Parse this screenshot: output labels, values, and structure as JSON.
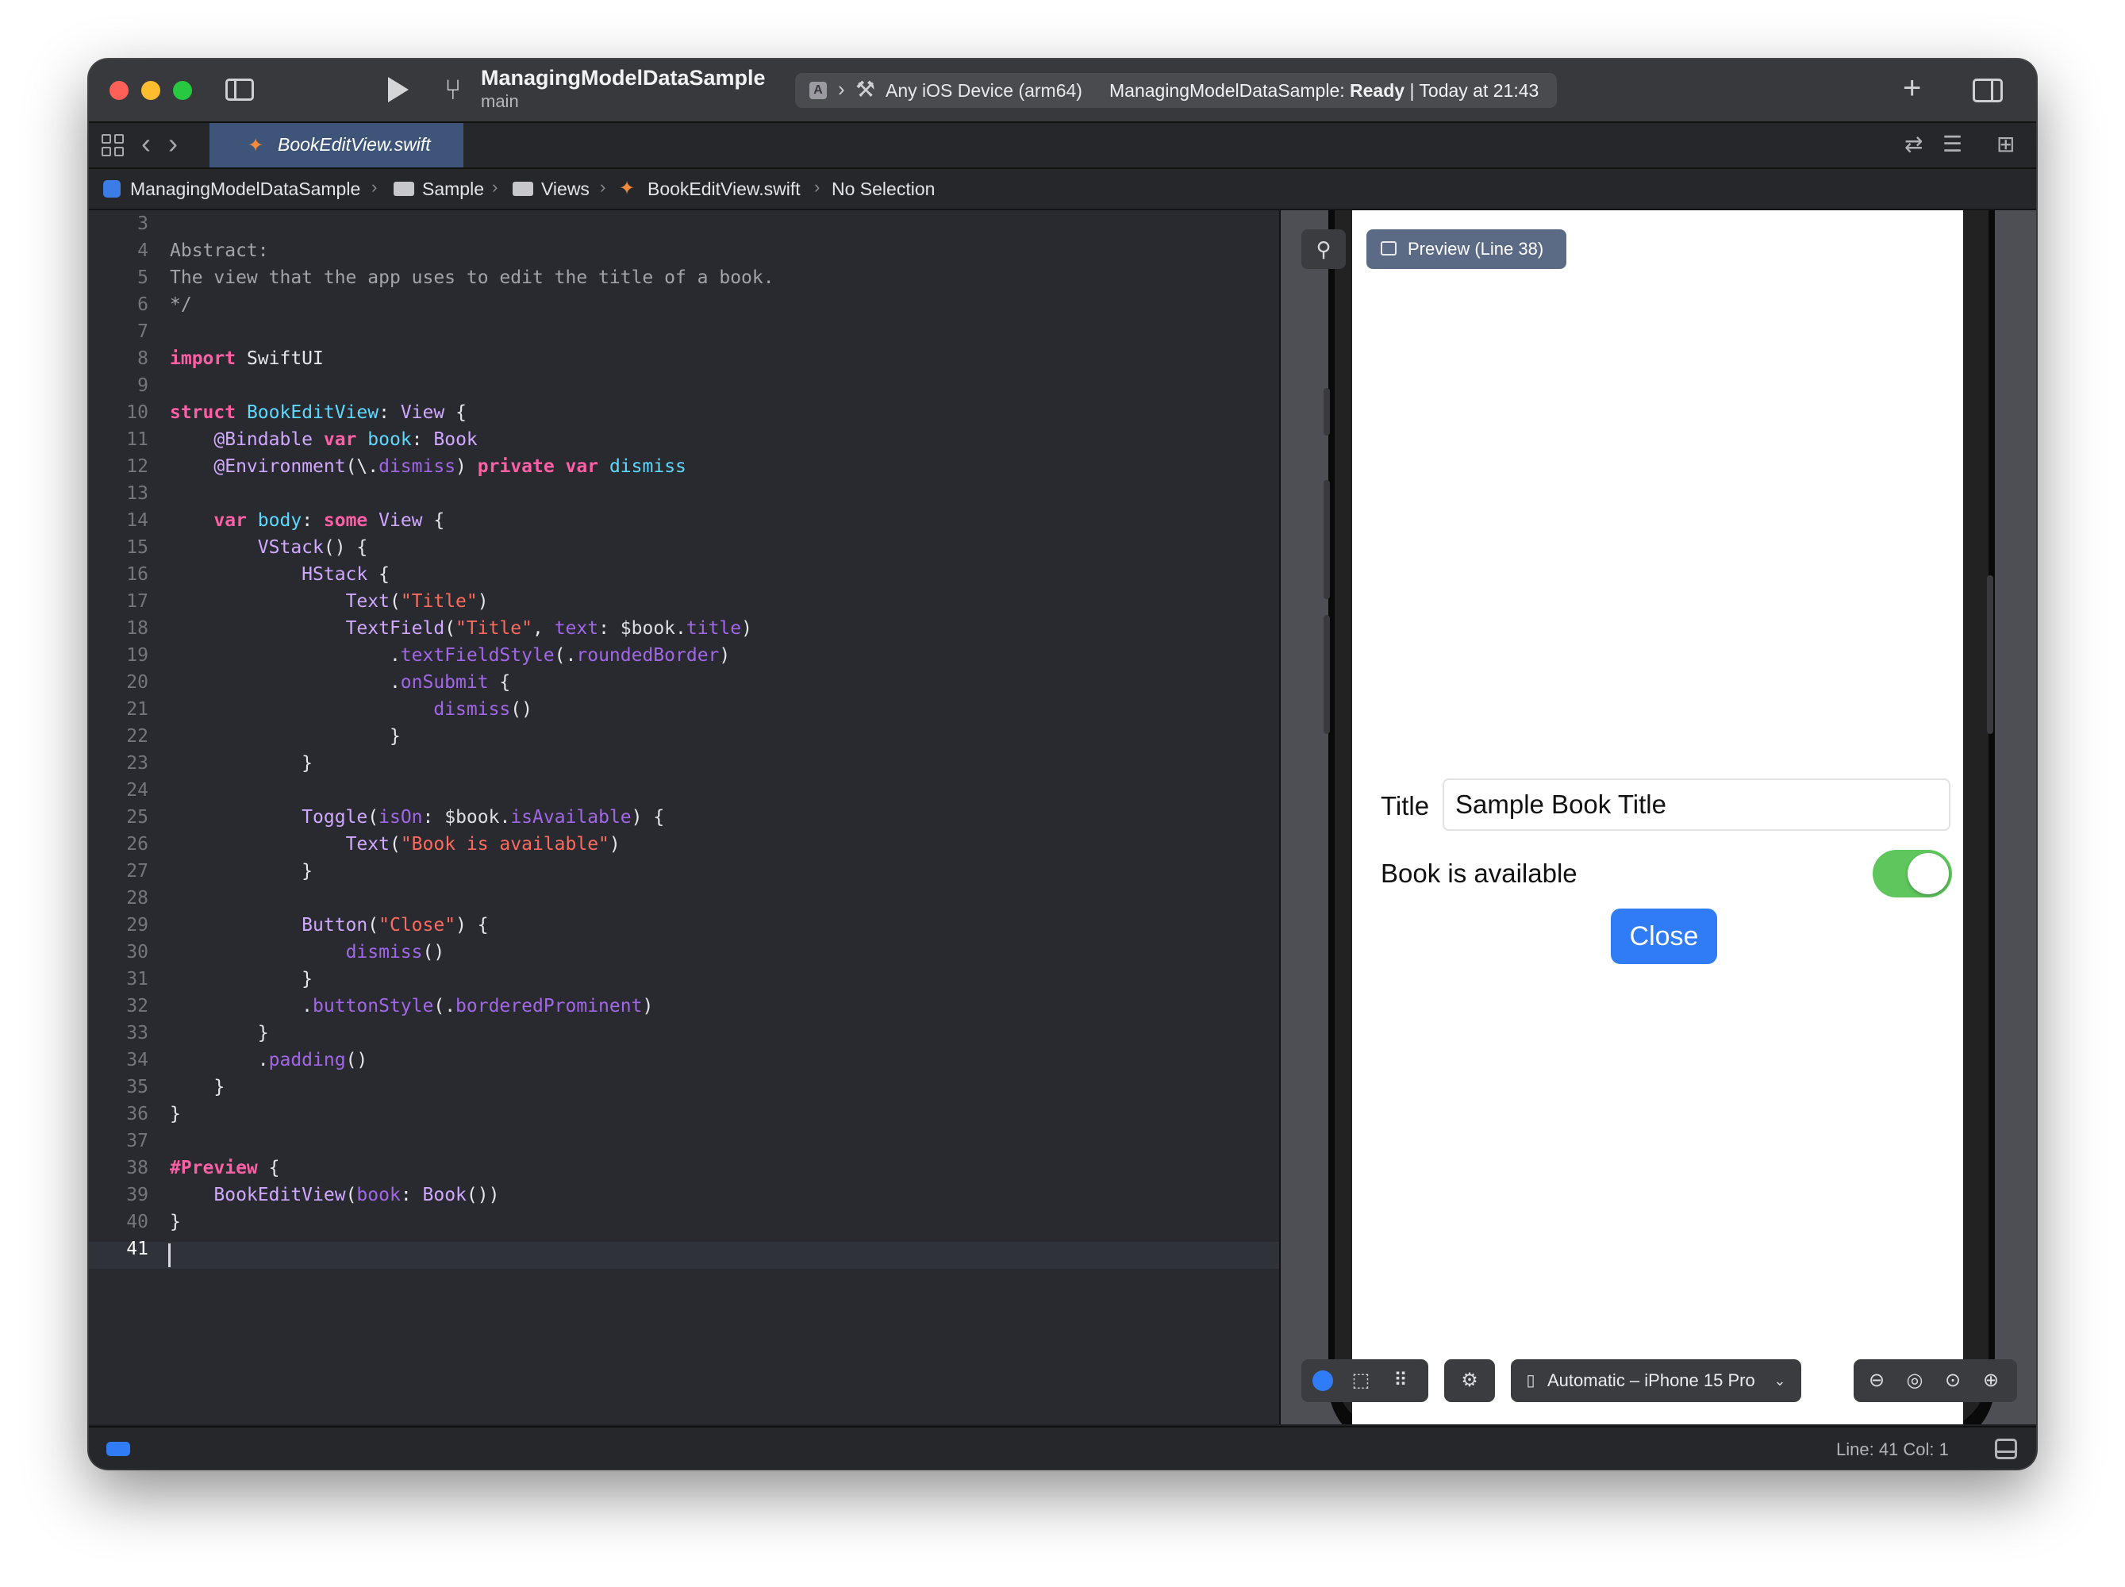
{
  "toolbar": {
    "project_name": "ManagingModelDataSample",
    "branch": "main",
    "device": "Any iOS Device (arm64)",
    "build_status_project": "ManagingModelDataSample:",
    "build_status_state": "Ready",
    "build_status_time": "| Today at 21:43"
  },
  "tabs": [
    {
      "label": "BookEditView.swift",
      "active": true
    }
  ],
  "breadcrumb": [
    "ManagingModelDataSample",
    "Sample",
    "Views",
    "BookEditView.swift",
    "No Selection"
  ],
  "editor": {
    "current_line": 41,
    "lines": [
      {
        "n": "3",
        "tokens": []
      },
      {
        "n": "4",
        "tokens": [
          [
            "cm",
            "Abstract:"
          ]
        ]
      },
      {
        "n": "5",
        "tokens": [
          [
            "cm",
            "The view that the app uses to edit the title of a book."
          ]
        ]
      },
      {
        "n": "6",
        "tokens": [
          [
            "cm",
            "*/"
          ]
        ]
      },
      {
        "n": "7",
        "tokens": []
      },
      {
        "n": "8",
        "tokens": [
          [
            "kw",
            "import"
          ],
          [
            "pl",
            " SwiftUI"
          ]
        ]
      },
      {
        "n": "9",
        "tokens": []
      },
      {
        "n": "10",
        "tokens": [
          [
            "kw",
            "struct"
          ],
          [
            "pl",
            " "
          ],
          [
            "ty",
            "BookEditView"
          ],
          [
            "pl",
            ": "
          ],
          [
            "ot",
            "View"
          ],
          [
            "pl",
            " {"
          ]
        ]
      },
      {
        "n": "11",
        "tokens": [
          [
            "pl",
            "    "
          ],
          [
            "ot",
            "@Bindable"
          ],
          [
            "pl",
            " "
          ],
          [
            "kw",
            "var"
          ],
          [
            "pl",
            " "
          ],
          [
            "ty",
            "book"
          ],
          [
            "pl",
            ": "
          ],
          [
            "ot",
            "Book"
          ]
        ]
      },
      {
        "n": "12",
        "tokens": [
          [
            "pl",
            "    "
          ],
          [
            "ot",
            "@Environment"
          ],
          [
            "pl",
            "(\\."
          ],
          [
            "nm",
            "dismiss"
          ],
          [
            "pl",
            ") "
          ],
          [
            "kw",
            "private"
          ],
          [
            "pl",
            " "
          ],
          [
            "kw",
            "var"
          ],
          [
            "pl",
            " "
          ],
          [
            "ty",
            "dismiss"
          ]
        ]
      },
      {
        "n": "13",
        "tokens": []
      },
      {
        "n": "14",
        "tokens": [
          [
            "pl",
            "    "
          ],
          [
            "kw",
            "var"
          ],
          [
            "pl",
            " "
          ],
          [
            "ty",
            "body"
          ],
          [
            "pl",
            ": "
          ],
          [
            "kw",
            "some"
          ],
          [
            "pl",
            " "
          ],
          [
            "ot",
            "View"
          ],
          [
            "pl",
            " {"
          ]
        ]
      },
      {
        "n": "15",
        "tokens": [
          [
            "pl",
            "        "
          ],
          [
            "ot",
            "VStack"
          ],
          [
            "pl",
            "() {"
          ]
        ]
      },
      {
        "n": "16",
        "tokens": [
          [
            "pl",
            "            "
          ],
          [
            "ot",
            "HStack"
          ],
          [
            "pl",
            " {"
          ]
        ]
      },
      {
        "n": "17",
        "tokens": [
          [
            "pl",
            "                "
          ],
          [
            "ot",
            "Text"
          ],
          [
            "pl",
            "("
          ],
          [
            "st",
            "\"Title\""
          ],
          [
            "pl",
            ")"
          ]
        ]
      },
      {
        "n": "18",
        "tokens": [
          [
            "pl",
            "                "
          ],
          [
            "ot",
            "TextField"
          ],
          [
            "pl",
            "("
          ],
          [
            "st",
            "\"Title\""
          ],
          [
            "pl",
            ", "
          ],
          [
            "nm",
            "text"
          ],
          [
            "pl",
            ": "
          ],
          [
            "sw",
            "$book"
          ],
          [
            "pl",
            "."
          ],
          [
            "nm",
            "title"
          ],
          [
            "pl",
            ")"
          ]
        ]
      },
      {
        "n": "19",
        "tokens": [
          [
            "pl",
            "                    ."
          ],
          [
            "nm",
            "textFieldStyle"
          ],
          [
            "pl",
            "(."
          ],
          [
            "nm",
            "roundedBorder"
          ],
          [
            "pl",
            ")"
          ]
        ]
      },
      {
        "n": "20",
        "tokens": [
          [
            "pl",
            "                    ."
          ],
          [
            "nm",
            "onSubmit"
          ],
          [
            "pl",
            " {"
          ]
        ]
      },
      {
        "n": "21",
        "tokens": [
          [
            "pl",
            "                        "
          ],
          [
            "nm",
            "dismiss"
          ],
          [
            "pl",
            "()"
          ]
        ]
      },
      {
        "n": "22",
        "tokens": [
          [
            "pl",
            "                    }"
          ]
        ]
      },
      {
        "n": "23",
        "tokens": [
          [
            "pl",
            "            }"
          ]
        ]
      },
      {
        "n": "24",
        "tokens": []
      },
      {
        "n": "25",
        "tokens": [
          [
            "pl",
            "            "
          ],
          [
            "ot",
            "Toggle"
          ],
          [
            "pl",
            "("
          ],
          [
            "nm",
            "isOn"
          ],
          [
            "pl",
            ": "
          ],
          [
            "sw",
            "$book"
          ],
          [
            "pl",
            "."
          ],
          [
            "nm",
            "isAvailable"
          ],
          [
            "pl",
            ") {"
          ]
        ]
      },
      {
        "n": "26",
        "tokens": [
          [
            "pl",
            "                "
          ],
          [
            "ot",
            "Text"
          ],
          [
            "pl",
            "("
          ],
          [
            "st",
            "\"Book is available\""
          ],
          [
            "pl",
            ")"
          ]
        ]
      },
      {
        "n": "27",
        "tokens": [
          [
            "pl",
            "            }"
          ]
        ]
      },
      {
        "n": "28",
        "tokens": []
      },
      {
        "n": "29",
        "tokens": [
          [
            "pl",
            "            "
          ],
          [
            "ot",
            "Button"
          ],
          [
            "pl",
            "("
          ],
          [
            "st",
            "\"Close\""
          ],
          [
            "pl",
            ") {"
          ]
        ]
      },
      {
        "n": "30",
        "tokens": [
          [
            "pl",
            "                "
          ],
          [
            "nm",
            "dismiss"
          ],
          [
            "pl",
            "()"
          ]
        ]
      },
      {
        "n": "31",
        "tokens": [
          [
            "pl",
            "            }"
          ]
        ]
      },
      {
        "n": "32",
        "tokens": [
          [
            "pl",
            "            ."
          ],
          [
            "nm",
            "buttonStyle"
          ],
          [
            "pl",
            "(."
          ],
          [
            "nm",
            "borderedProminent"
          ],
          [
            "pl",
            ")"
          ]
        ]
      },
      {
        "n": "33",
        "tokens": [
          [
            "pl",
            "        }"
          ]
        ]
      },
      {
        "n": "34",
        "tokens": [
          [
            "pl",
            "        ."
          ],
          [
            "nm",
            "padding"
          ],
          [
            "pl",
            "()"
          ]
        ]
      },
      {
        "n": "35",
        "tokens": [
          [
            "pl",
            "    }"
          ]
        ]
      },
      {
        "n": "36",
        "tokens": [
          [
            "pl",
            "}"
          ]
        ]
      },
      {
        "n": "37",
        "tokens": []
      },
      {
        "n": "38",
        "tokens": [
          [
            "kw",
            "#Preview"
          ],
          [
            "pl",
            " {"
          ]
        ]
      },
      {
        "n": "39",
        "tokens": [
          [
            "pl",
            "    "
          ],
          [
            "ot",
            "BookEditView"
          ],
          [
            "pl",
            "("
          ],
          [
            "nm",
            "book"
          ],
          [
            "pl",
            ": "
          ],
          [
            "ot",
            "Book"
          ],
          [
            "pl",
            "())"
          ]
        ]
      },
      {
        "n": "40",
        "tokens": [
          [
            "pl",
            "}"
          ]
        ]
      },
      {
        "n": "41",
        "tokens": []
      }
    ]
  },
  "preview": {
    "pill_label": "Preview (Line 38)",
    "device_selector": "Automatic – iPhone 15 Pro",
    "app": {
      "title_label": "Title",
      "title_value": "Sample Book Title",
      "toggle_label": "Book is available",
      "toggle_on": true,
      "close_label": "Close"
    }
  },
  "status_bar": {
    "position": "Line: 41  Col: 1"
  },
  "icons": {
    "branch": "branch-icon",
    "hammer": "hammer-icon",
    "pin": "pin-icon",
    "plus": "plus-icon"
  },
  "colors": {
    "accent": "#2f7cf6",
    "toggle_on": "#5fc65d",
    "keyword": "#fc5fa3",
    "string": "#fc6a5d",
    "type": "#5dd8ff"
  }
}
